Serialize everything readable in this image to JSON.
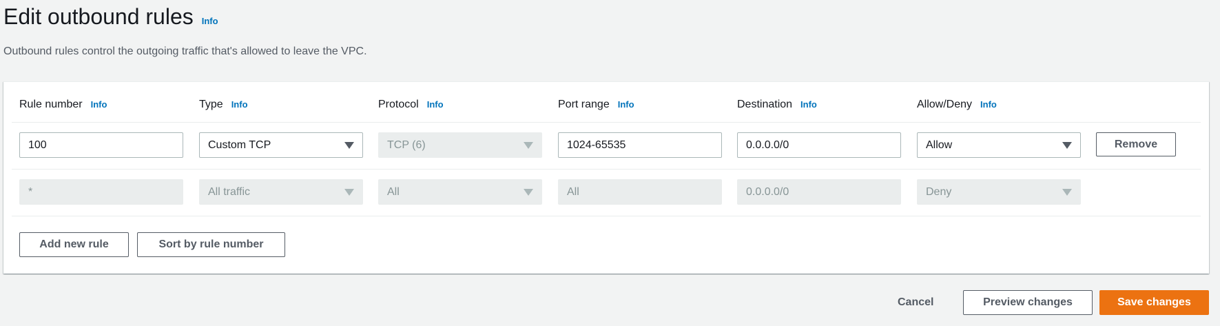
{
  "header": {
    "title": "Edit outbound rules",
    "info": "Info",
    "description": "Outbound rules control the outgoing traffic that's allowed to leave the VPC."
  },
  "table": {
    "columns": [
      {
        "label": "Rule number",
        "info": "Info"
      },
      {
        "label": "Type",
        "info": "Info"
      },
      {
        "label": "Protocol",
        "info": "Info"
      },
      {
        "label": "Port range",
        "info": "Info"
      },
      {
        "label": "Destination",
        "info": "Info"
      },
      {
        "label": "Allow/Deny",
        "info": "Info"
      }
    ],
    "rows": [
      {
        "rule_number": "100",
        "type": "Custom TCP",
        "protocol": "TCP (6)",
        "port_range": "1024-65535",
        "destination": "0.0.0.0/0",
        "allow_deny": "Allow",
        "remove_label": "Remove",
        "editable": true
      },
      {
        "rule_number": "*",
        "type": "All traffic",
        "protocol": "All",
        "port_range": "All",
        "destination": "0.0.0.0/0",
        "allow_deny": "Deny",
        "editable": false
      }
    ]
  },
  "actions": {
    "add_new_rule": "Add new rule",
    "sort_by_rule_number": "Sort by rule number"
  },
  "footer": {
    "cancel": "Cancel",
    "preview": "Preview changes",
    "save": "Save changes"
  },
  "colors": {
    "link": "#0073bb",
    "primary": "#ec7211",
    "background": "#f2f3f3"
  }
}
